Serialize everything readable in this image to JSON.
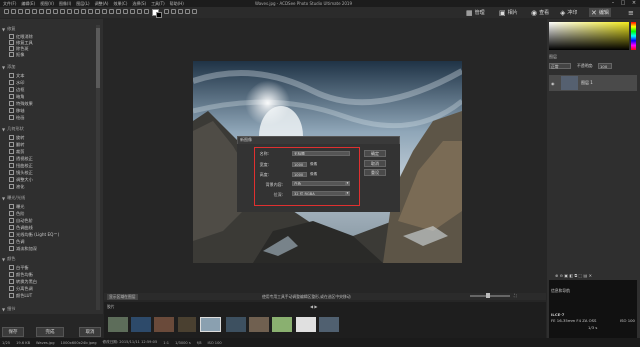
{
  "titlebar": {
    "menus": [
      "文件(F)",
      "编辑(E)",
      "视图(V)",
      "图像(I)",
      "图层(L)",
      "调整(A)",
      "效果(C)",
      "选择(S)",
      "工具(T)",
      "帮助(H)"
    ],
    "window_title": "Waves.jpg - ACDSee Photo Studio Ultimate 2019"
  },
  "modes": [
    {
      "label": "管理",
      "icon": "grid-icon"
    },
    {
      "label": "相片",
      "icon": "photo-icon"
    },
    {
      "label": "查看",
      "icon": "eye-icon"
    },
    {
      "label": "冲印",
      "icon": "develop-icon"
    },
    {
      "label": "编辑",
      "icon": "edit-icon"
    }
  ],
  "left_panel": {
    "sections": [
      {
        "title": "修复",
        "items": [
          "红眼消除",
          "修复工具",
          "除色斑",
          "抠像"
        ]
      },
      {
        "title": "添加",
        "items": [
          "文本",
          "水印",
          "边框",
          "暗角",
          "特殊效果",
          "移轴",
          "绘画"
        ]
      },
      {
        "title": "几何形状",
        "items": [
          "旋转",
          "翻转",
          "裁剪",
          "透视校正",
          "扭曲校正",
          "镜头校正",
          "调整大小",
          "液化"
        ]
      },
      {
        "title": "曝光/光线",
        "items": [
          "曝光",
          "色阶",
          "自动色阶",
          "色调曲线",
          "光线均衡 (Light EQ™)",
          "色调",
          "减淡和加深"
        ]
      },
      {
        "title": "颜色",
        "items": [
          "白平衡",
          "颜色均衡",
          "转换为黑白",
          "分离色调",
          "颜色LUT"
        ]
      },
      {
        "title": "细节",
        "items": []
      }
    ]
  },
  "dialog": {
    "title": "新图像",
    "name_label": "名称:",
    "name_value": "无标题",
    "width_label": "宽度:",
    "width_value": "1000",
    "width_unit": "像素",
    "height_label": "高度:",
    "height_value": "1000",
    "height_unit": "像素",
    "bg_label": "背景内容:",
    "bg_value": "白色",
    "depth_label": "位深:",
    "depth_value": "32 位 RGBA",
    "ok": "确定",
    "cancel": "取消",
    "reset": "重设"
  },
  "canvas": {
    "tab_name": "显示区域在图层",
    "hint": "使用专用工具手动调整编辑区整形,或在选区中央移动"
  },
  "bottom_buttons": {
    "save": "保存",
    "done": "完成",
    "cancel": "取消"
  },
  "statusbar": [
    "1/25",
    "19.6 KB",
    "Waves.jpg",
    "1000x600x24b jpeg",
    "修改日期: 2015/11/11 12:59:05",
    "1:1",
    "1/3000 s",
    "f/8",
    "ISO 100"
  ],
  "right_panel": {
    "tab_label": "图层",
    "blend_mode": "正常",
    "opacity_label": "不透明度:",
    "opacity_value": "100",
    "layer_name": "图层 1",
    "nav_title": "信息和导航",
    "camera_line1": "ILCE-7",
    "camera_line2": "FE 16-35mm F4 ZA OSS",
    "zoom": "1/3 s",
    "iso": "ISO 100"
  },
  "colors": {
    "accent_yellow": "#f2ea1e",
    "highlight_red": "#e03030"
  }
}
